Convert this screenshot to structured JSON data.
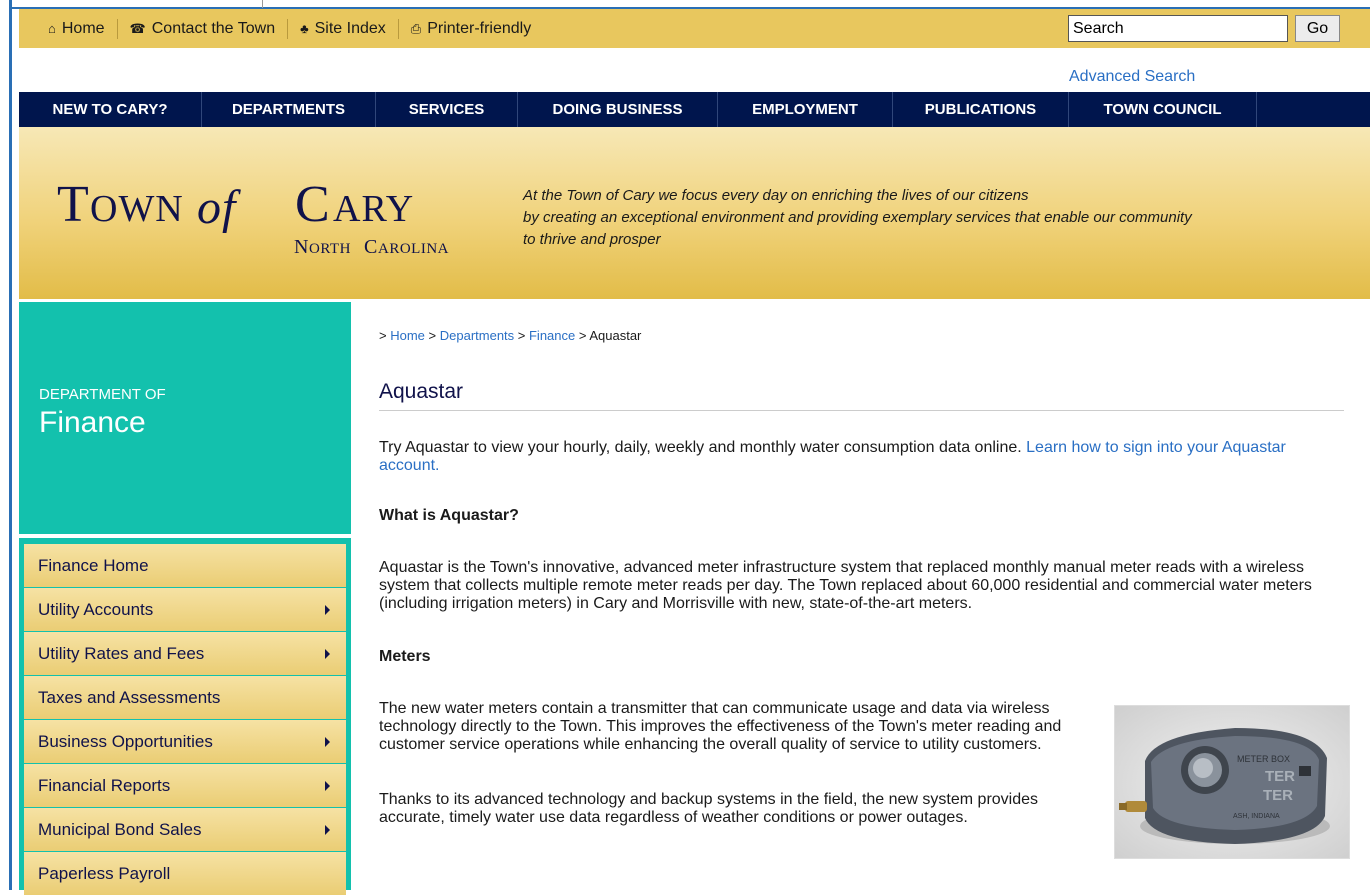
{
  "utility_bar": {
    "links": [
      {
        "icon": "home-icon",
        "glyph": "⌂",
        "label": "Home"
      },
      {
        "icon": "phone-icon",
        "glyph": "☎",
        "label": "Contact the Town"
      },
      {
        "icon": "sitemap-icon",
        "glyph": "♣",
        "label": "Site Index"
      },
      {
        "icon": "printer-icon",
        "glyph": "⎙",
        "label": "Printer-friendly"
      }
    ],
    "search_value": "Search",
    "go_label": "Go",
    "advanced_search": "Advanced Search"
  },
  "main_nav": [
    {
      "label": "NEW TO CARY?"
    },
    {
      "label": "DEPARTMENTS"
    },
    {
      "label": "SERVICES"
    },
    {
      "label": "DOING BUSINESS"
    },
    {
      "label": "EMPLOYMENT"
    },
    {
      "label": "PUBLICATIONS"
    },
    {
      "label": "TOWN COUNCIL"
    }
  ],
  "banner": {
    "logo_main": "TOWN of CARY",
    "logo_sub": "NORTH CAROLINA",
    "tagline_1": "At the Town of Cary we focus every day on enriching the lives of our citizens",
    "tagline_2": "by creating an exceptional environment and providing exemplary services that enable our community",
    "tagline_3": "to thrive and prosper"
  },
  "department": {
    "small": "DEPARTMENT OF",
    "big": "Finance"
  },
  "side_nav": [
    {
      "label": "Finance Home",
      "has_arrow": false
    },
    {
      "label": "Utility Accounts",
      "has_arrow": true
    },
    {
      "label": "Utility Rates and Fees",
      "has_arrow": true
    },
    {
      "label": "Taxes and Assessments",
      "has_arrow": false
    },
    {
      "label": "Business Opportunities",
      "has_arrow": true
    },
    {
      "label": "Financial Reports",
      "has_arrow": true
    },
    {
      "label": "Municipal Bond Sales",
      "has_arrow": true
    },
    {
      "label": "Paperless Payroll",
      "has_arrow": false
    }
  ],
  "breadcrumb": {
    "prefix": "> ",
    "home": "Home",
    "departments": "Departments",
    "finance": "Finance",
    "current": "Aquastar"
  },
  "content": {
    "title": "Aquastar",
    "intro": "Try Aquastar to view your hourly, daily, weekly and monthly water consumption data online.",
    "intro_link": "Learn how to sign into your Aquastar account.",
    "h_what": "What is Aquastar?",
    "what_p": "Aquastar is the Town's innovative, advanced meter infrastructure system that replaced monthly manual meter reads with a wireless system that collects multiple remote meter reads per day. The Town replaced about 60,000 residential and commercial water meters (including irrigation meters) in Cary and Morrisville with new, state-of-the-art meters.",
    "h_meters": "Meters",
    "meters_p1": "The new water meters contain a transmitter that can communicate usage and data via wireless technology directly to the Town. This improves the effectiveness of the Town's meter reading and customer service operations while enhancing the overall quality of service to utility customers.",
    "meters_p2": "Thanks to its advanced technology and backup systems in the field, the new system provides accurate, timely water use data regardless of weather conditions or power outages.",
    "photo_text_1": "METER BOX",
    "photo_text_2": "TER",
    "photo_text_3": "TER",
    "photo_text_4": "ASH, INDIANA"
  }
}
